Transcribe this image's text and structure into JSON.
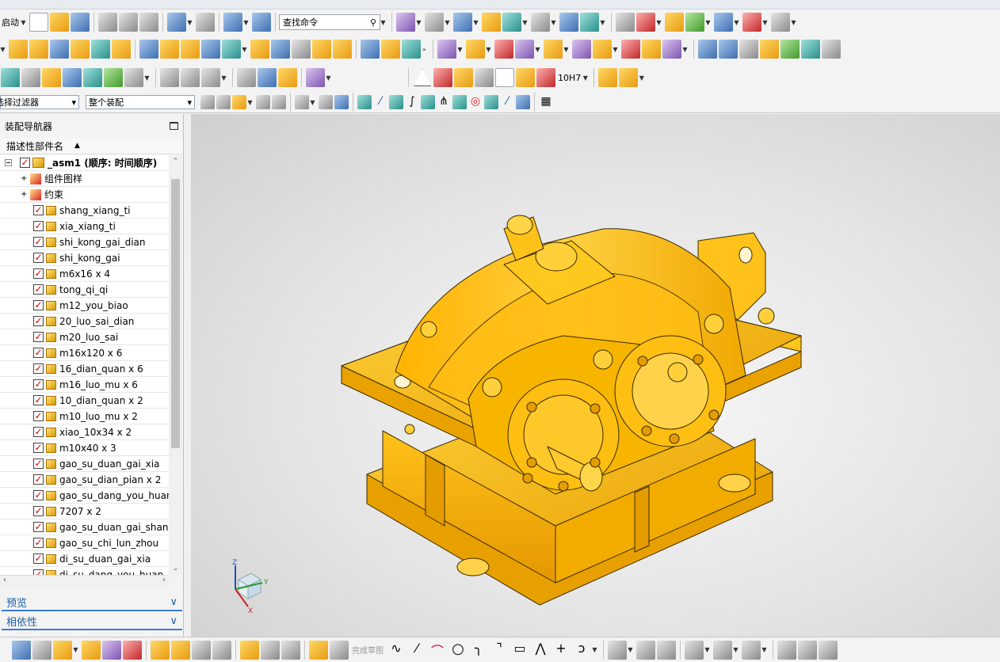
{
  "toolbar": {
    "start_label": "启动",
    "command_search_placeholder": "查找命令",
    "filter_select": "选择过滤器",
    "assembly_scope_select": "整个装配",
    "tolerance_label": "10H7"
  },
  "navigator": {
    "title": "装配导航器",
    "column_header": "描述性部件名",
    "root": "_asm1 (顺序: 时间顺序)",
    "groups": [
      "组件图样",
      "约束"
    ],
    "parts": [
      "shang_xiang_ti",
      "xia_xiang_ti",
      "shi_kong_gai_dian",
      "shi_kong_gai",
      "m6x16 x 4",
      "tong_qi_qi",
      "m12_you_biao",
      "20_luo_sai_dian",
      "m20_luo_sai",
      "m16x120 x 6",
      "16_dian_quan x 6",
      "m16_luo_mu x 6",
      "10_dian_quan x 2",
      "m10_luo_mu x 2",
      "xiao_10x34 x 2",
      "m10x40 x 3",
      "gao_su_duan_gai_xia",
      "gao_su_dian_pian x 2",
      "gao_su_dang_you_huan",
      "7207 x 2",
      "gao_su_duan_gai_shang",
      "gao_su_chi_lun_zhou",
      "di_su_duan_gai_xia",
      "di_su_dang_you_huan_xia"
    ]
  },
  "panels": {
    "preview": "预览",
    "dependencies": "相依性"
  },
  "viewport": {
    "model_color": "#f5b800",
    "triad": {
      "x": "X",
      "y": "Y",
      "z": "Z"
    }
  },
  "bottom_toolbar": {
    "finish_sketch": "完成草图"
  }
}
